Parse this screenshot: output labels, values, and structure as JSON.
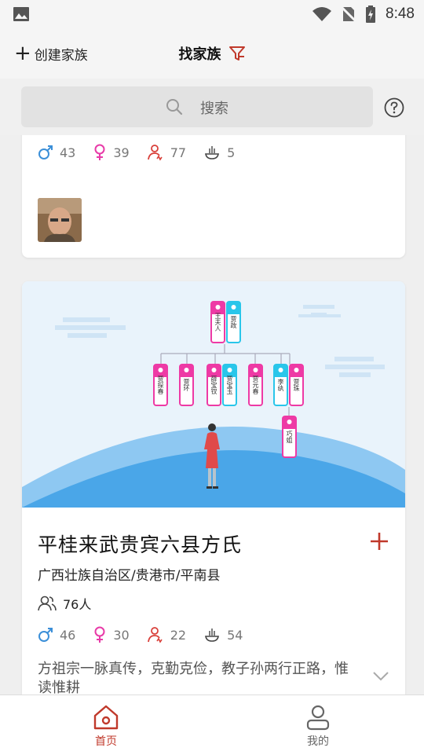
{
  "status_bar": {
    "time": "8:48"
  },
  "topbar": {
    "create_label": "创建家族",
    "title": "找家族"
  },
  "search": {
    "placeholder": "搜索"
  },
  "cards": [
    {
      "stats": {
        "male": "43",
        "female": "39",
        "deceased": "77",
        "generations": "5"
      }
    },
    {
      "name": "平桂来武贵宾六县方氏",
      "region": "广西壮族自治区/贵港市/平南县",
      "members": "76人",
      "stats": {
        "male": "46",
        "female": "30",
        "deceased": "22",
        "generations": "54"
      },
      "motto": "方祖宗一脉真传，克勤克俭，教子孙两行正路，惟读惟耕",
      "tree_nodes": {
        "n1": "王夫人",
        "n2": "贾政",
        "n3": "贾探春",
        "n4": "贾环",
        "n5": "薛宝钗",
        "n6": "贾宝玉",
        "n7": "贾元春",
        "n8": "李纨",
        "n9": "贾珠",
        "n10": "巧姐"
      }
    }
  ],
  "bottom_nav": {
    "home": "首页",
    "mine": "我的"
  },
  "colors": {
    "accent": "#c0392b",
    "male": "#3b8fd8",
    "female": "#e83aa8",
    "tree_pink": "#ee3aa5",
    "tree_cyan": "#29c6ea"
  }
}
